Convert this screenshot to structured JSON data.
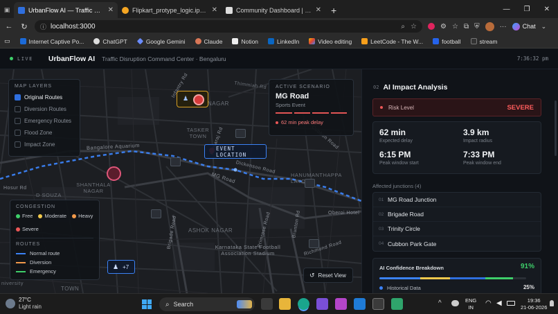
{
  "browser": {
    "tabs": [
      {
        "title": "UrbanFlow AI — Traffic Disruption",
        "active": true
      },
      {
        "title": "Flipkart_protype_logic.ipynb - Cola",
        "active": false
      },
      {
        "title": "Community Dashboard | HackerE",
        "active": false
      }
    ],
    "new_tab": "+",
    "url": "localhost:3000",
    "profile_label": "Chat",
    "bookmarks": [
      "Internet Captive Po...",
      "ChatGPT",
      "Google Gemini",
      "Claude",
      "Notion",
      "LinkedIn",
      "Video editing",
      "LeetCode - The W...",
      "football",
      "stream"
    ]
  },
  "app": {
    "live_label": "LIVE",
    "brand": "UrbanFlow AI",
    "subtitle": "Traffic Disruption Command Center · Bengaluru",
    "clock": "7:36:32 pm"
  },
  "map": {
    "layers_title": "MAP LAYERS",
    "layers": [
      {
        "label": "Original Routes",
        "checked": true
      },
      {
        "label": "Diversion Routes",
        "checked": false
      },
      {
        "label": "Emergency Routes",
        "checked": false
      },
      {
        "label": "Flood Zone",
        "checked": false
      },
      {
        "label": "Impact Zone",
        "checked": false
      }
    ],
    "congestion_title": "CONGESTION",
    "congestion": [
      {
        "label": "Free",
        "color": "#3ecf6a"
      },
      {
        "label": "Moderate",
        "color": "#f2c94c"
      },
      {
        "label": "Heavy",
        "color": "#f2994a"
      },
      {
        "label": "Severe",
        "color": "#eb5757"
      }
    ],
    "routes_title": "ROUTES",
    "routes": [
      {
        "label": "Normal route",
        "color": "#3b82f6"
      },
      {
        "label": "Diversion",
        "color": "#f2994a"
      },
      {
        "label": "Emergency",
        "color": "#3ecf6a"
      }
    ],
    "scenario": {
      "kicker": "ACTIVE SCENARIO",
      "name": "MG Road",
      "type": "Sports Event",
      "delay": "62 min peak delay"
    },
    "event_label": "EVENT LOCATION",
    "cluster_count": "+7",
    "reset_label": "Reset View",
    "place_names": [
      "Thimmiah Rd",
      "Bangalore Aquarium",
      "NAGAR",
      "TASKER TOWN",
      "SHANTHALA NAGAR",
      "D SOUZA",
      "Hosur Rd",
      "MG Road",
      "Dickenson Road",
      "HANUMANTHAPPA LAYOUT",
      "Oberoi Hotel",
      "ASHOK NAGAR",
      "Brigade Road",
      "Primrose Road",
      "Brunton Rd",
      "Richmond Road",
      "Karnataka State Football Association Stadium",
      "niversity",
      "TOWN",
      "Infantry Rd",
      "Kamaraj Rd",
      "Cubbon Road"
    ]
  },
  "analysis": {
    "index": "02",
    "title": "AI Impact Analysis",
    "risk_label": "Risk Level",
    "risk_value": "SEVERE",
    "metrics": [
      {
        "value": "62 min",
        "label": "Expected delay"
      },
      {
        "value": "3.9 km",
        "label": "Impact radius"
      },
      {
        "value": "6:15 PM",
        "label": "Peak window start"
      },
      {
        "value": "7:33 PM",
        "label": "Peak window end"
      }
    ],
    "junctions_title": "Affected junctions (4)",
    "junctions": [
      {
        "n": "01",
        "name": "MG Road Junction"
      },
      {
        "n": "02",
        "name": "Brigade Road"
      },
      {
        "n": "03",
        "name": "Trinity Circle"
      },
      {
        "n": "04",
        "name": "Cubbon Park Gate"
      }
    ],
    "confidence_title": "AI Confidence Breakdown",
    "confidence_value": "91%",
    "confidence_bar_fraction": 0.91,
    "breakdown": [
      {
        "label": "Historical Data",
        "value": "25%"
      }
    ]
  },
  "taskbar": {
    "weather_temp": "27°C",
    "weather_desc": "Light rain",
    "search_placeholder": "Search",
    "lang": "ENG",
    "region": "IN",
    "time": "19:36",
    "date": "21-06-2026"
  }
}
